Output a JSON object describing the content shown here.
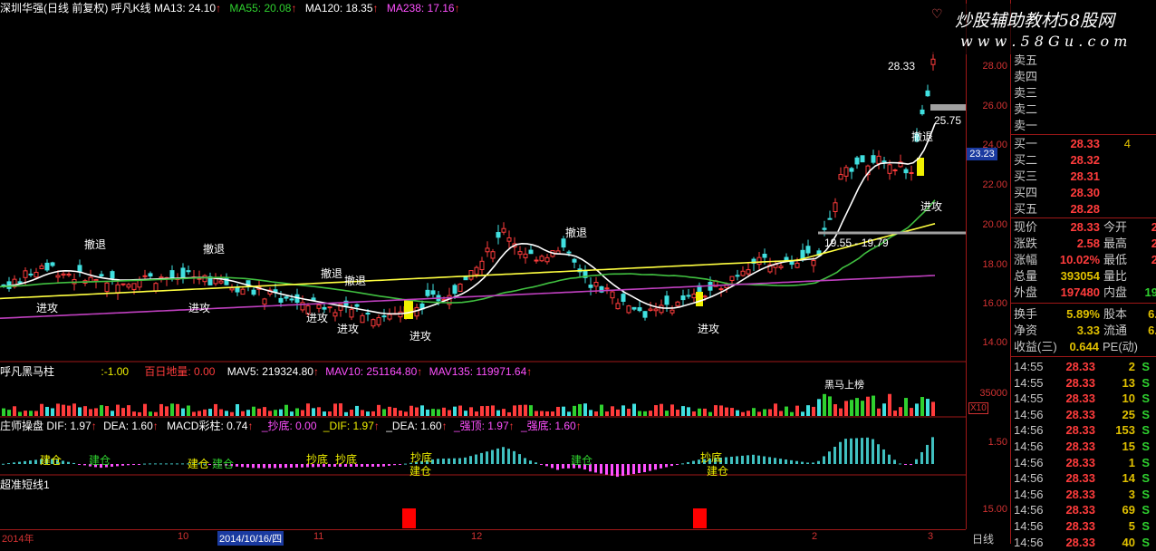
{
  "header": {
    "stock": "深圳华强(日线 前复权)",
    "indicator": "呼凡K线",
    "ma13": "MA13: 24.10",
    "ma55": "MA55: 20.08",
    "ma120": "MA120: 18.35",
    "ma238": "MA238: 17.16",
    "up_arrow": "↑"
  },
  "watermark": {
    "main": "炒股辅助教材58股网",
    "url": "w w w . 5 8 G u . c o m"
  },
  "axis_main": [
    "28.00",
    "26.00",
    "24.00",
    "22.00",
    "20.00",
    "18.00",
    "16.00",
    "14.00"
  ],
  "axis_vol": "35000",
  "axis_vol_unit": "X10",
  "axis_macd": "1.50",
  "axis_bot": "15.00",
  "period_label": "日线",
  "price_tag": "23.23",
  "annotations": {
    "high_price": "28.33",
    "mark_price": "25.75",
    "range": "19.55 - 19.79",
    "retreat": "撤退",
    "attack": "进攻",
    "attack2": "进攻"
  },
  "vol_header": {
    "name": "呼凡黑马柱",
    "val": ":-1.00",
    "baiday": "百日地量: 0.00",
    "mav5": "MAV5: 219324.80",
    "mav10": "MAV10: 251164.80",
    "mav135": "MAV135: 119971.64",
    "black_horse": "黑马上榜"
  },
  "macd_header": {
    "name": "庄师操盘",
    "dif": "DIF: 1.97",
    "dea": "DEA: 1.60",
    "macd": "MACD彩柱: 0.74",
    "chaodi": "_抄底: 0.00",
    "dif2": "_DIF: 1.97",
    "dea2": "_DEA: 1.60",
    "qiangding": "_强顶: 1.97",
    "qiangdi": "_强底: 1.60",
    "jiancang": "建仓",
    "chaodi_lbl": "抄底",
    "jiancang2": "建仓"
  },
  "bot_header": {
    "name": "超准短线1"
  },
  "dates": [
    {
      "label": "2014年"
    },
    {
      "label": "10"
    },
    {
      "label": "2014/10/16/四"
    },
    {
      "label": "11"
    },
    {
      "label": "12"
    },
    {
      "label": "2"
    },
    {
      "label": "3"
    }
  ],
  "orderbook": {
    "sells": [
      {
        "label": "卖五"
      },
      {
        "label": "卖四"
      },
      {
        "label": "卖三"
      },
      {
        "label": "卖二"
      },
      {
        "label": "卖一"
      }
    ],
    "buys": [
      {
        "label": "买一",
        "price": "28.33",
        "vol": "4"
      },
      {
        "label": "买二",
        "price": "28.32",
        "vol": ""
      },
      {
        "label": "买三",
        "price": "28.31",
        "vol": ""
      },
      {
        "label": "买四",
        "price": "28.30",
        "vol": ""
      },
      {
        "label": "买五",
        "price": "28.28",
        "vol": ""
      }
    ]
  },
  "stats": [
    {
      "l1": "现价",
      "v1": "28.33",
      "l2": "今开",
      "v2": "2"
    },
    {
      "l1": "涨跌",
      "v1": "2.58",
      "l2": "最高",
      "v2": "2"
    },
    {
      "l1": "涨幅",
      "v1": "10.02%",
      "l2": "最低",
      "v2": "2"
    },
    {
      "l1": "总量",
      "v1": "393054",
      "l2": "量比",
      "v2": ""
    },
    {
      "l1": "外盘",
      "v1": "197480",
      "l2": "内盘",
      "v2": "19"
    }
  ],
  "fundamentals": [
    {
      "l1": "换手",
      "v1": "5.89%",
      "l2": "股本",
      "v2": "6."
    },
    {
      "l1": "净资",
      "v1": "3.33",
      "l2": "流通",
      "v2": "6."
    },
    {
      "l1": "收益(三)",
      "v1": "0.644",
      "l2": "PE(动)",
      "v2": ""
    }
  ],
  "ticks": [
    {
      "time": "14:55",
      "price": "28.33",
      "vol": "2",
      "side": "S"
    },
    {
      "time": "14:55",
      "price": "28.33",
      "vol": "13",
      "side": "S"
    },
    {
      "time": "14:55",
      "price": "28.33",
      "vol": "10",
      "side": "S"
    },
    {
      "time": "14:56",
      "price": "28.33",
      "vol": "25",
      "side": "S"
    },
    {
      "time": "14:56",
      "price": "28.33",
      "vol": "153",
      "side": "S"
    },
    {
      "time": "14:56",
      "price": "28.33",
      "vol": "15",
      "side": "S"
    },
    {
      "time": "14:56",
      "price": "28.33",
      "vol": "1",
      "side": "S"
    },
    {
      "time": "14:56",
      "price": "28.33",
      "vol": "14",
      "side": "S"
    },
    {
      "time": "14:56",
      "price": "28.33",
      "vol": "3",
      "side": "S"
    },
    {
      "time": "14:56",
      "price": "28.33",
      "vol": "69",
      "side": "S"
    },
    {
      "time": "14:56",
      "price": "28.33",
      "vol": "5",
      "side": "S"
    },
    {
      "time": "14:56",
      "price": "28.33",
      "vol": "40",
      "side": "S"
    }
  ],
  "colors": {
    "up": "#ff3c3c",
    "down": "#40e0e0",
    "ma13": "#ffffff",
    "ma55": "#40c040",
    "ma120": "#ffff40",
    "ma238": "#c040c0"
  }
}
